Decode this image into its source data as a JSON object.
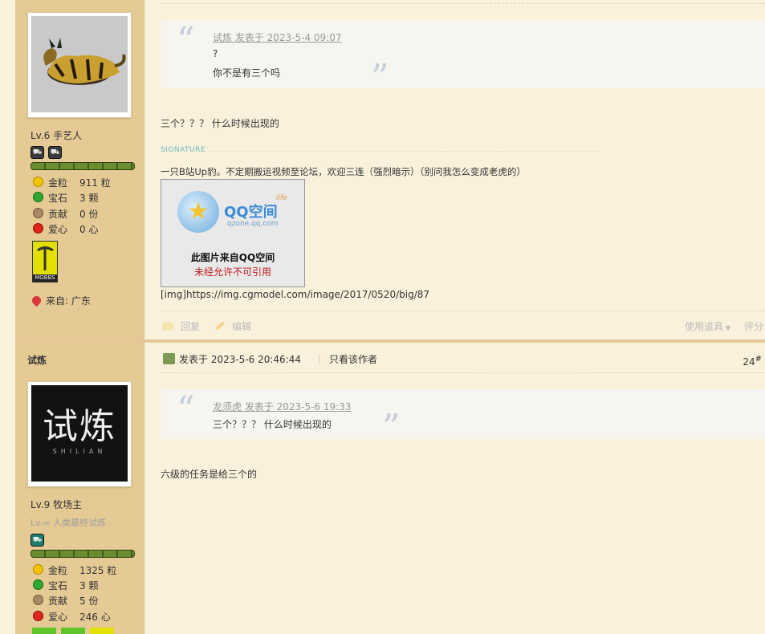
{
  "post1": {
    "user": {
      "level": "Lv.6 手艺人",
      "stats": [
        {
          "label": "金粒",
          "value": "911 粒",
          "icon": "gold-coin-icon",
          "color": "#f3c300"
        },
        {
          "label": "宝石",
          "value": "3 颗",
          "icon": "gem-icon",
          "color": "#2fa832"
        },
        {
          "label": "贡献",
          "value": "0 份",
          "icon": "contribution-icon",
          "color": "#a98866"
        },
        {
          "label": "爱心",
          "value": "0 心",
          "icon": "heart-icon",
          "color": "#e0251b"
        }
      ],
      "medal": "MOBBS",
      "from_label": "来自:",
      "from_value": "广东"
    },
    "quote": {
      "meta": "试炼 发表于 2023-5-4 09:07",
      "line1": "?",
      "line2": "你不是有三个吗"
    },
    "content": "三个？？？ 什么时候出现的",
    "signature_label": "SIGNATURE",
    "signature_text": "一只B站Up豹。不定期搬运视频至论坛，欢迎三连（强烈暗示）（别问我怎么变成老虎的）",
    "image": {
      "brand": "QQ空间",
      "domain": "qzone.qq.com",
      "life": "life",
      "caption1": "此图片来自QQ空间",
      "caption2": "未经允许不可引用"
    },
    "img_link": "[img]https://img.cgmodel.com/image/2017/0520/big/87",
    "actions": {
      "reply": "回复",
      "edit": "编辑",
      "tools": "使用道具",
      "rate": "评分"
    }
  },
  "post2": {
    "user": {
      "name": "试炼",
      "avatar_text": "试炼",
      "avatar_sub": "SHILIAN",
      "level": "Lv.9 牧场主",
      "title": "Lv.∞ 人类最终试炼",
      "stats": [
        {
          "label": "金粒",
          "value": "1325 粒",
          "icon": "gold-coin-icon",
          "color": "#f3c300"
        },
        {
          "label": "宝石",
          "value": "3 颗",
          "icon": "gem-icon",
          "color": "#2fa832"
        },
        {
          "label": "贡献",
          "value": "5 份",
          "icon": "contribution-icon",
          "color": "#a98866"
        },
        {
          "label": "爱心",
          "value": "246 心",
          "icon": "heart-icon",
          "color": "#e0251b"
        }
      ]
    },
    "header": {
      "posted": "发表于 2023-5-6 20:46:44",
      "only_author": "只看该作者",
      "floor": "24",
      "floor_mark": "#"
    },
    "quote": {
      "meta": "龙须虎 发表于 2023-5-6 19:33",
      "line1": "三个？？？ 什么时候出现的"
    },
    "content": "六级的任务是给三个的"
  }
}
